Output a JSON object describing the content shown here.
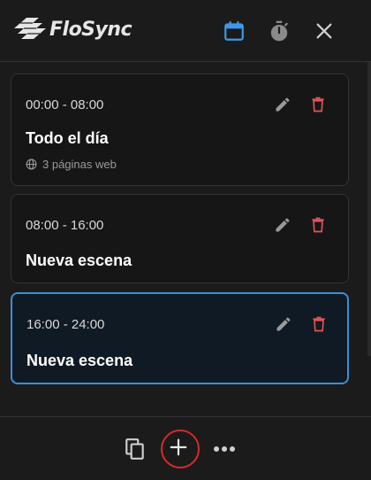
{
  "app": {
    "name": "FloSync"
  },
  "header": {
    "icons": [
      "calendar-icon",
      "timer-icon",
      "close-icon"
    ],
    "colors": {
      "calendar_active": "#3b9be8",
      "timer": "#8a8a8a",
      "close": "#d0d0d0"
    }
  },
  "scenes": [
    {
      "time": "00:00 - 08:00",
      "title": "Todo el día",
      "meta": "3 páginas web",
      "active": false
    },
    {
      "time": "08:00 - 16:00",
      "title": "Nueva escena",
      "active": false
    },
    {
      "time": "16:00 - 24:00",
      "title": "Nueva escena",
      "active": true
    }
  ],
  "card_actions": {
    "edit_icon": "pencil-icon",
    "delete_icon": "trash-icon",
    "delete_color": "#e05555",
    "edit_color": "#9a9a9a"
  },
  "footer": {
    "icons": [
      "copy-icon",
      "add-icon",
      "more-icon"
    ],
    "highlight_color": "#d62a2a"
  },
  "colors": {
    "accent": "#3b8fd6",
    "background": "#1b1b1b",
    "card_bg": "#161616",
    "active_card_bg": "#0f1a24"
  }
}
